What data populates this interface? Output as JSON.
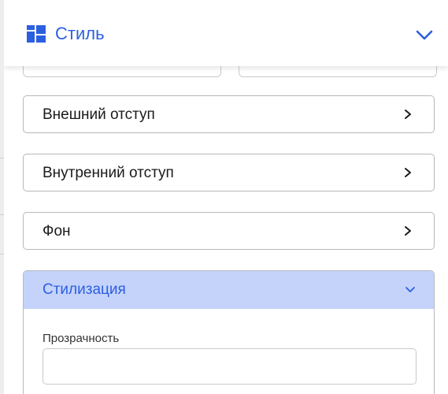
{
  "header": {
    "title": "Стиль",
    "icon": "layout-grid-icon",
    "toggle_icon": "chevron-down-icon"
  },
  "sections": [
    {
      "label": "Внешний отступ",
      "icon": "chevron-right-icon"
    },
    {
      "label": "Внутренний отступ",
      "icon": "chevron-right-icon"
    },
    {
      "label": "Фон",
      "icon": "chevron-right-icon"
    }
  ],
  "expanded_section": {
    "label": "Стилизация",
    "icon": "chevron-down-icon",
    "fields": [
      {
        "label": "Прозрачность",
        "value": "",
        "placeholder": ""
      }
    ]
  },
  "colors": {
    "accent": "#2c5fe0",
    "active_header_bg": "#c5d3fb",
    "border": "#b8b8be"
  }
}
